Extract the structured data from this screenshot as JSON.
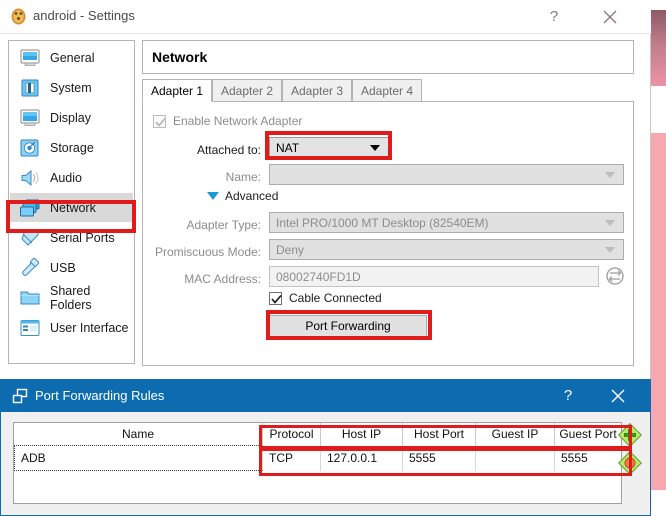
{
  "window": {
    "title": "android - Settings",
    "icon": "virtualbox-icon",
    "help_label": "?",
    "close_label": "close-icon"
  },
  "sidebar": {
    "items": [
      {
        "label": "General",
        "icon": "monitor-icon",
        "selected": false
      },
      {
        "label": "System",
        "icon": "chip-icon",
        "selected": false
      },
      {
        "label": "Display",
        "icon": "display-icon",
        "selected": false
      },
      {
        "label": "Storage",
        "icon": "harddisk-icon",
        "selected": false
      },
      {
        "label": "Audio",
        "icon": "speaker-icon",
        "selected": false
      },
      {
        "label": "Network",
        "icon": "network-icon",
        "selected": true
      },
      {
        "label": "Serial Ports",
        "icon": "serial-port-icon",
        "selected": false
      },
      {
        "label": "USB",
        "icon": "usb-icon",
        "selected": false
      },
      {
        "label": "Shared Folders",
        "icon": "folder-icon",
        "selected": false
      },
      {
        "label": "User Interface",
        "icon": "user-interface-icon",
        "selected": false
      }
    ]
  },
  "panel": {
    "title": "Network",
    "tabs": [
      {
        "label": "Adapter 1",
        "active": true
      },
      {
        "label": "Adapter 2",
        "active": false
      },
      {
        "label": "Adapter 3",
        "active": false
      },
      {
        "label": "Adapter 4",
        "active": false
      }
    ],
    "enable_adapter": {
      "label": "Enable Network Adapter",
      "checked": true,
      "disabled": true
    },
    "attached_to": {
      "label": "Attached to:",
      "value": "NAT",
      "highlighted": true
    },
    "name": {
      "label": "Name:",
      "value": "",
      "disabled": true
    },
    "advanced": {
      "label": "Advanced",
      "expanded": true
    },
    "adapter_type": {
      "label": "Adapter Type:",
      "value": "Intel PRO/1000 MT Desktop (82540EM)",
      "disabled": true
    },
    "promiscuous_mode": {
      "label": "Promiscuous Mode:",
      "value": "Deny",
      "disabled": true
    },
    "mac_address": {
      "label": "MAC Address:",
      "value": "08002740FD1D",
      "disabled": true,
      "refresh_icon": "refresh-mac-icon"
    },
    "cable_connected": {
      "label": "Cable Connected",
      "checked": true
    },
    "port_forwarding_button": {
      "label": "Port Forwarding",
      "highlighted": true
    }
  },
  "dialog": {
    "title": "Port Forwarding Rules",
    "icon": "port-forwarding-icon",
    "help_label": "?",
    "close_label": "close-icon",
    "table": {
      "columns": [
        "Name",
        "Protocol",
        "Host IP",
        "Host Port",
        "Guest IP",
        "Guest Port"
      ],
      "rows": [
        {
          "Name": "ADB",
          "Protocol": "TCP",
          "Host IP": "127.0.0.1",
          "Host Port": "5555",
          "Guest IP": "",
          "Guest Port": "5555"
        }
      ]
    },
    "actions": [
      {
        "name": "add-rule-button",
        "icon": "green-plus-icon"
      },
      {
        "name": "remove-rule-button",
        "icon": "orange-minus-icon"
      }
    ]
  },
  "colors": {
    "annotation": "#e01b1b",
    "dialog_titlebar": "#0d6cb0",
    "selection": "#d9d9d9"
  }
}
